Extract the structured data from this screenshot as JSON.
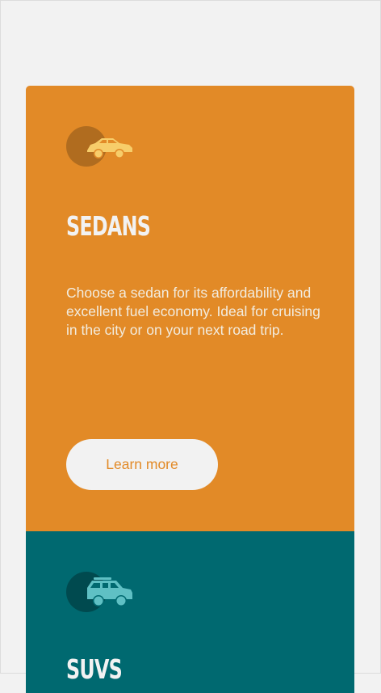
{
  "colors": {
    "page_background": "#f2f2f2",
    "sedans_card": "#e28a27",
    "suvs_card": "#006970",
    "text_light": "#f2f2f2",
    "sedan_icon": "#f7cd6a",
    "suv_icon": "#5fc0c4"
  },
  "cards": [
    {
      "icon": "sedan-icon",
      "title": "SEDANS",
      "description": "Choose a sedan for its affordability and excellent fuel economy. Ideal for cruising in the city or on your next road trip.",
      "button_label": "Learn more"
    },
    {
      "icon": "suv-icon",
      "title": "SUVS"
    }
  ]
}
